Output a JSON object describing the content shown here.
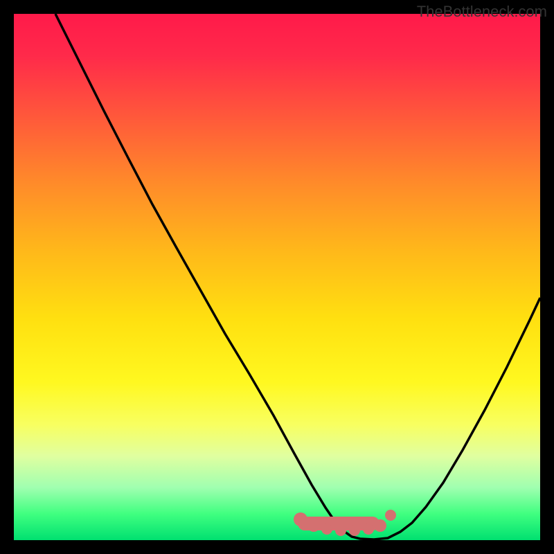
{
  "watermark": "TheBottleneck.com",
  "chart_data": {
    "type": "line",
    "title": "",
    "xlabel": "",
    "ylabel": "",
    "xlim": [
      0,
      100
    ],
    "ylim": [
      0,
      100
    ],
    "series": [
      {
        "name": "curve",
        "x": [
          8,
          12,
          16,
          20,
          24,
          28,
          32,
          36,
          40,
          44,
          48,
          52,
          55,
          58,
          61,
          63,
          65,
          70,
          74,
          78,
          82,
          86,
          90,
          94,
          98,
          100
        ],
        "y": [
          100,
          91,
          82,
          73,
          64,
          56,
          47,
          38,
          30,
          22,
          14,
          8,
          4,
          1,
          0,
          0,
          0,
          0,
          2,
          7,
          14,
          23,
          33,
          44,
          56,
          62
        ]
      }
    ],
    "highlight_band": {
      "x_start": 52,
      "x_end": 72,
      "y": 2,
      "color": "#d47070"
    },
    "annotations": [],
    "grid": false,
    "legend": false
  },
  "colors": {
    "background": "#000000",
    "curve": "#000000",
    "highlight": "#d47070",
    "gradient_top": "#ff1a4a",
    "gradient_bottom": "#00e070"
  }
}
